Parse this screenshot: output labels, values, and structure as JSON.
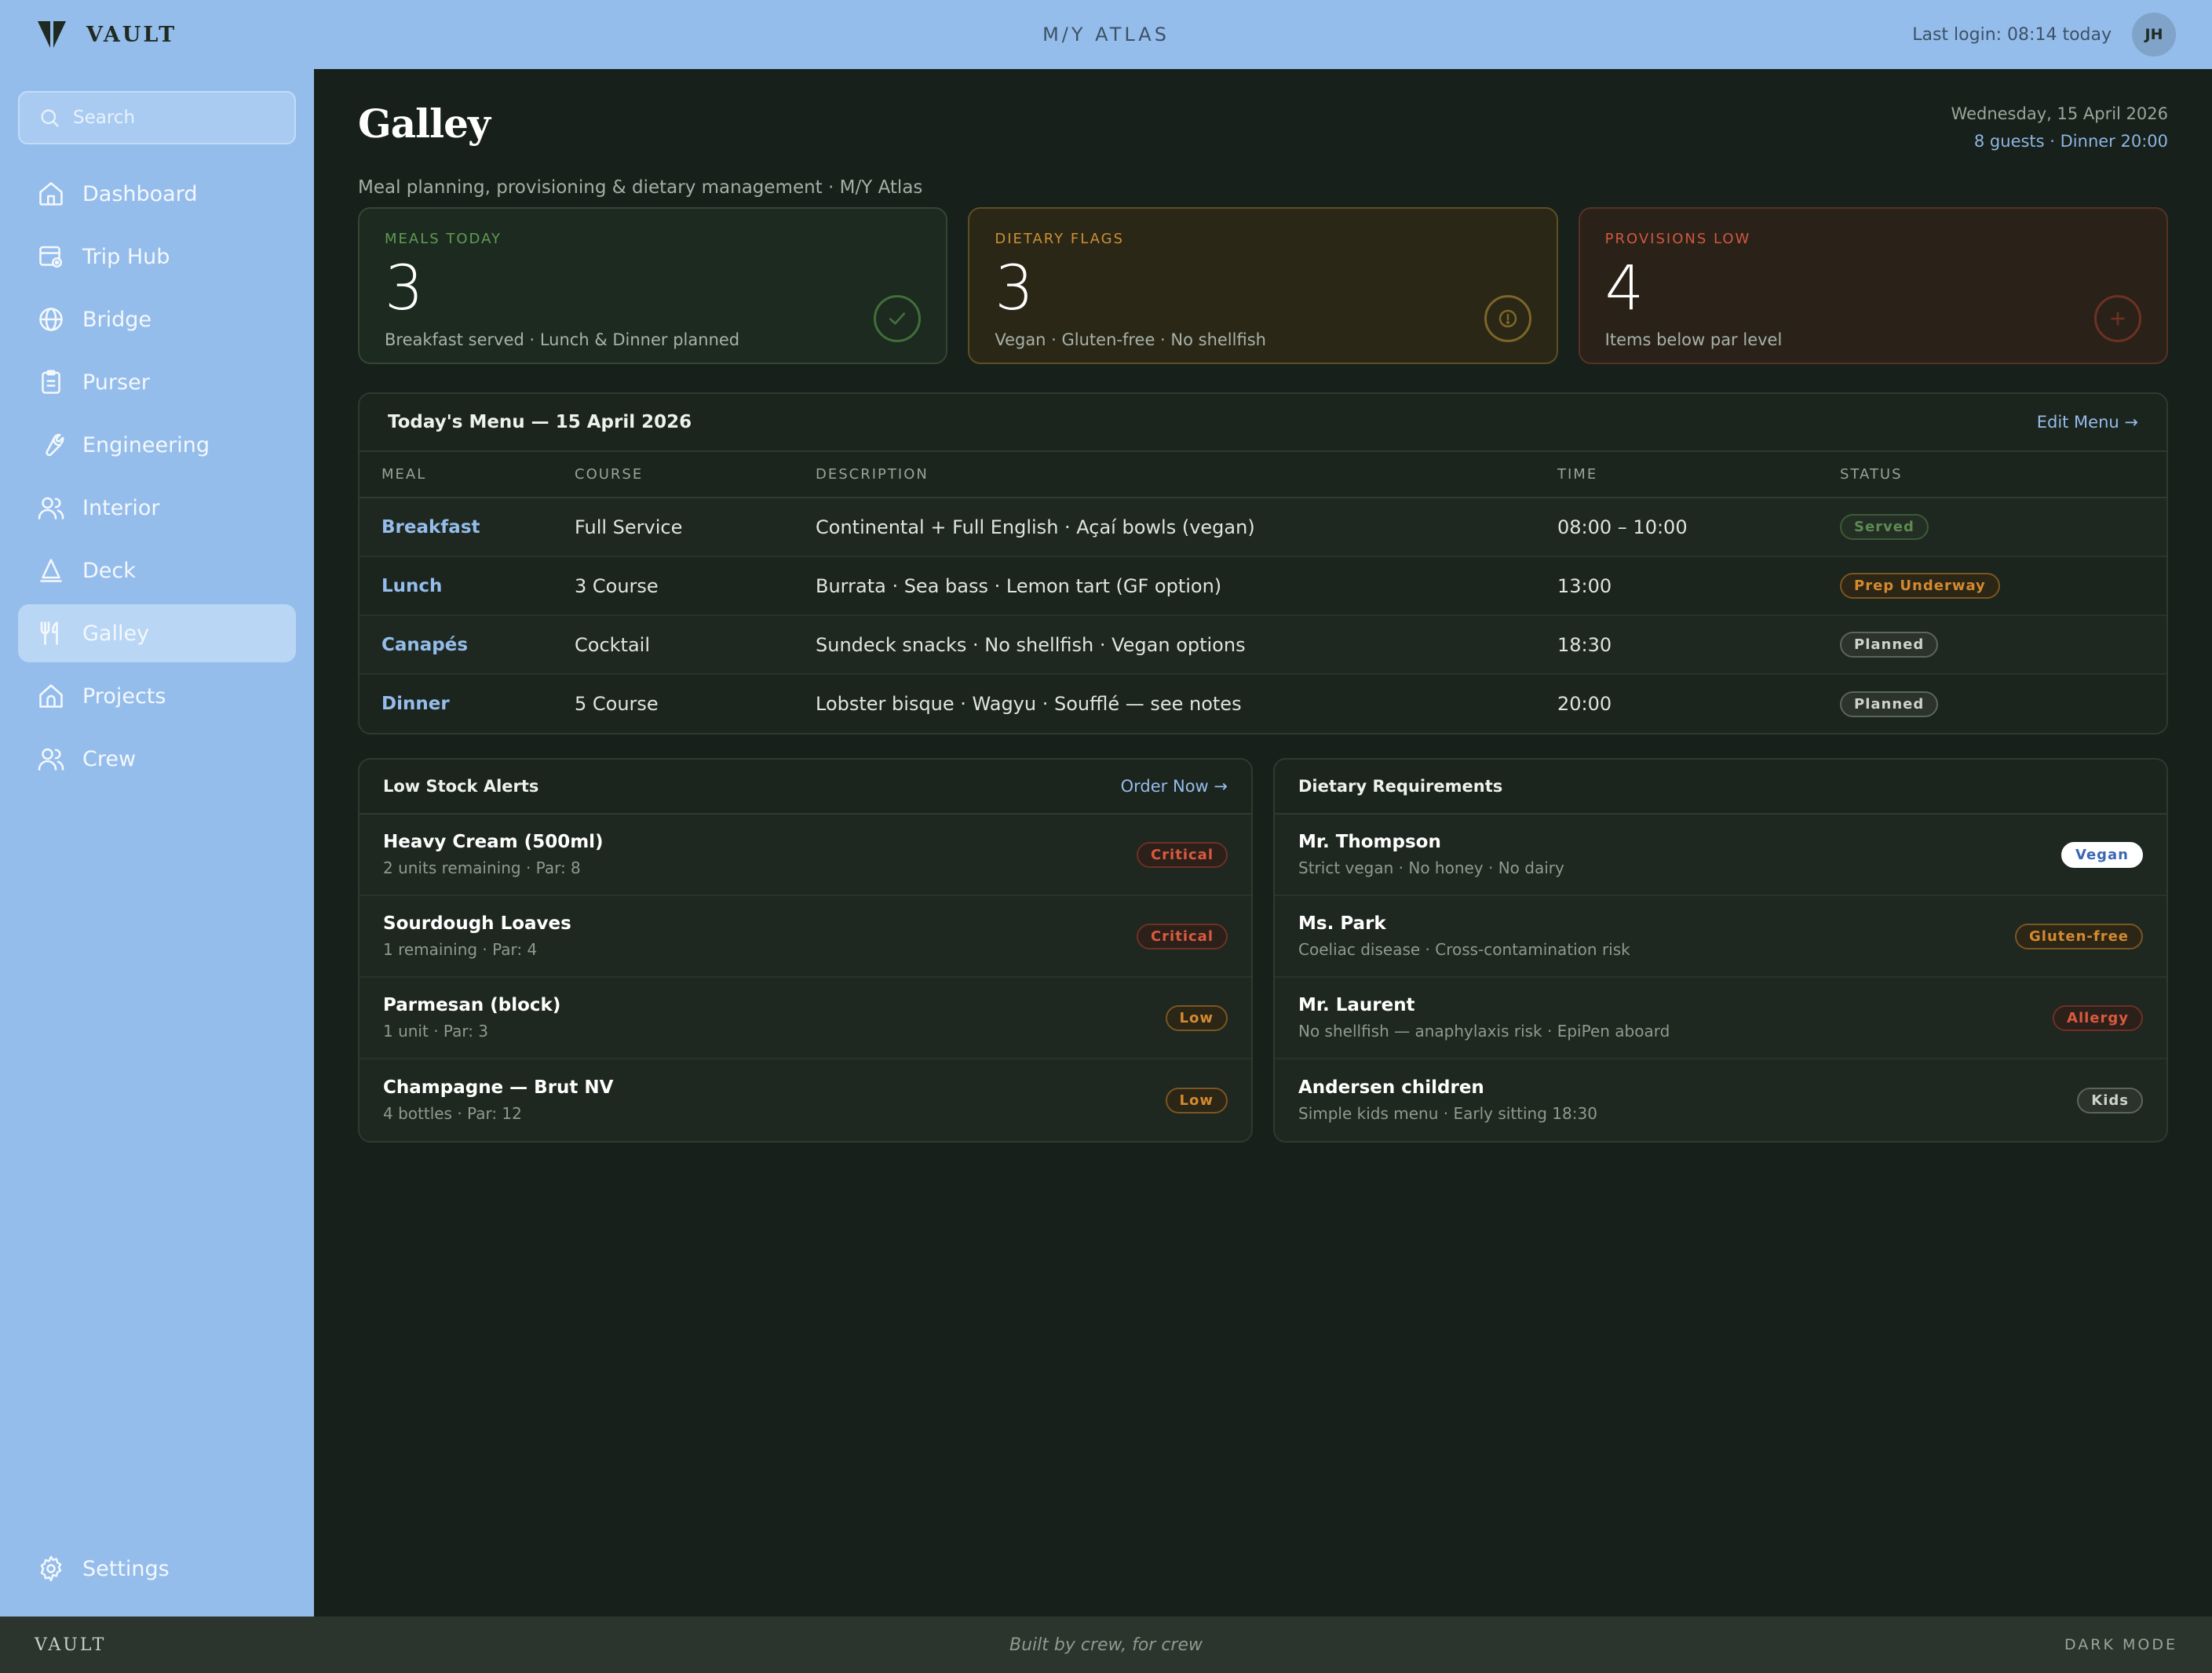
{
  "brand": {
    "name": "VAULT"
  },
  "topbar": {
    "vessel": "M/Y ATLAS",
    "last_login": "Last login: 08:14 today",
    "avatar_initials": "JH"
  },
  "sidebar": {
    "search_placeholder": "Search",
    "items": [
      {
        "label": "Dashboard",
        "icon": "home-icon"
      },
      {
        "label": "Trip Hub",
        "icon": "trip-icon"
      },
      {
        "label": "Bridge",
        "icon": "globe-icon"
      },
      {
        "label": "Purser",
        "icon": "clipboard-icon"
      },
      {
        "label": "Engineering",
        "icon": "wrench-icon"
      },
      {
        "label": "Interior",
        "icon": "users-icon"
      },
      {
        "label": "Deck",
        "icon": "sail-icon"
      },
      {
        "label": "Galley",
        "icon": "utensils-icon",
        "active": true
      },
      {
        "label": "Projects",
        "icon": "house-icon"
      },
      {
        "label": "Crew",
        "icon": "users-icon"
      }
    ],
    "settings_label": "Settings"
  },
  "page": {
    "title": "Galley",
    "subtitle": "Meal planning, provisioning & dietary management · M/Y Atlas",
    "date": "Wednesday, 15 April 2026",
    "guests": "8 guests · Dinner 20:00"
  },
  "stats": [
    {
      "label": "MEALS TODAY",
      "value": "3",
      "desc": "Breakfast served · Lunch & Dinner planned",
      "tone": "green",
      "icon": "check-icon"
    },
    {
      "label": "DIETARY FLAGS",
      "value": "3",
      "desc": "Vegan · Gluten-free · No shellfish",
      "tone": "amber",
      "icon": "info-icon"
    },
    {
      "label": "PROVISIONS LOW",
      "value": "4",
      "desc": "Items below par level",
      "tone": "red",
      "icon": "plus-icon"
    }
  ],
  "menu": {
    "title": "Today's Menu — 15 April 2026",
    "edit_label": "Edit Menu →",
    "columns": [
      "MEAL",
      "COURSE",
      "DESCRIPTION",
      "TIME",
      "STATUS"
    ],
    "rows": [
      {
        "meal": "Breakfast",
        "course": "Full Service",
        "description": "Continental + Full English · Açaí bowls (vegan)",
        "time": "08:00 – 10:00",
        "status": "Served"
      },
      {
        "meal": "Lunch",
        "course": "3 Course",
        "description": "Burrata · Sea bass · Lemon tart (GF option)",
        "time": "13:00",
        "status": "Prep Underway"
      },
      {
        "meal": "Canapés",
        "course": "Cocktail",
        "description": "Sundeck snacks · No shellfish · Vegan options",
        "time": "18:30",
        "status": "Planned"
      },
      {
        "meal": "Dinner",
        "course": "5 Course",
        "description": "Lobster bisque · Wagyu · Soufflé — see notes",
        "time": "20:00",
        "status": "Planned"
      }
    ]
  },
  "low_stock": {
    "title": "Low Stock Alerts",
    "action_label": "Order Now →",
    "items": [
      {
        "name": "Heavy Cream (500ml)",
        "detail": "2 units remaining · Par: 8",
        "badge": "Critical"
      },
      {
        "name": "Sourdough Loaves",
        "detail": "1 remaining · Par: 4",
        "badge": "Critical"
      },
      {
        "name": "Parmesan (block)",
        "detail": "1 unit · Par: 3",
        "badge": "Low"
      },
      {
        "name": "Champagne — Brut NV",
        "detail": "4 bottles · Par: 12",
        "badge": "Low"
      }
    ]
  },
  "dietary": {
    "title": "Dietary Requirements",
    "items": [
      {
        "name": "Mr. Thompson",
        "detail": "Strict vegan · No honey · No dairy",
        "badge": "Vegan"
      },
      {
        "name": "Ms. Park",
        "detail": "Coeliac disease · Cross-contamination risk",
        "badge": "Gluten-free"
      },
      {
        "name": "Mr. Laurent",
        "detail": "No shellfish — anaphylaxis risk · EpiPen aboard",
        "badge": "Allergy"
      },
      {
        "name": "Andersen children",
        "detail": "Simple kids menu · Early sitting 18:30",
        "badge": "Kids"
      }
    ]
  },
  "footer": {
    "brand": "VAULT",
    "tagline": "Built by crew, for crew",
    "mode": "DARK MODE"
  },
  "colors": {
    "sidebar": "#95bdeb",
    "background": "#17201a",
    "accent": "#95bdeb",
    "green": "#5f9b54",
    "amber": "#cc8f33",
    "red": "#d0583f"
  }
}
